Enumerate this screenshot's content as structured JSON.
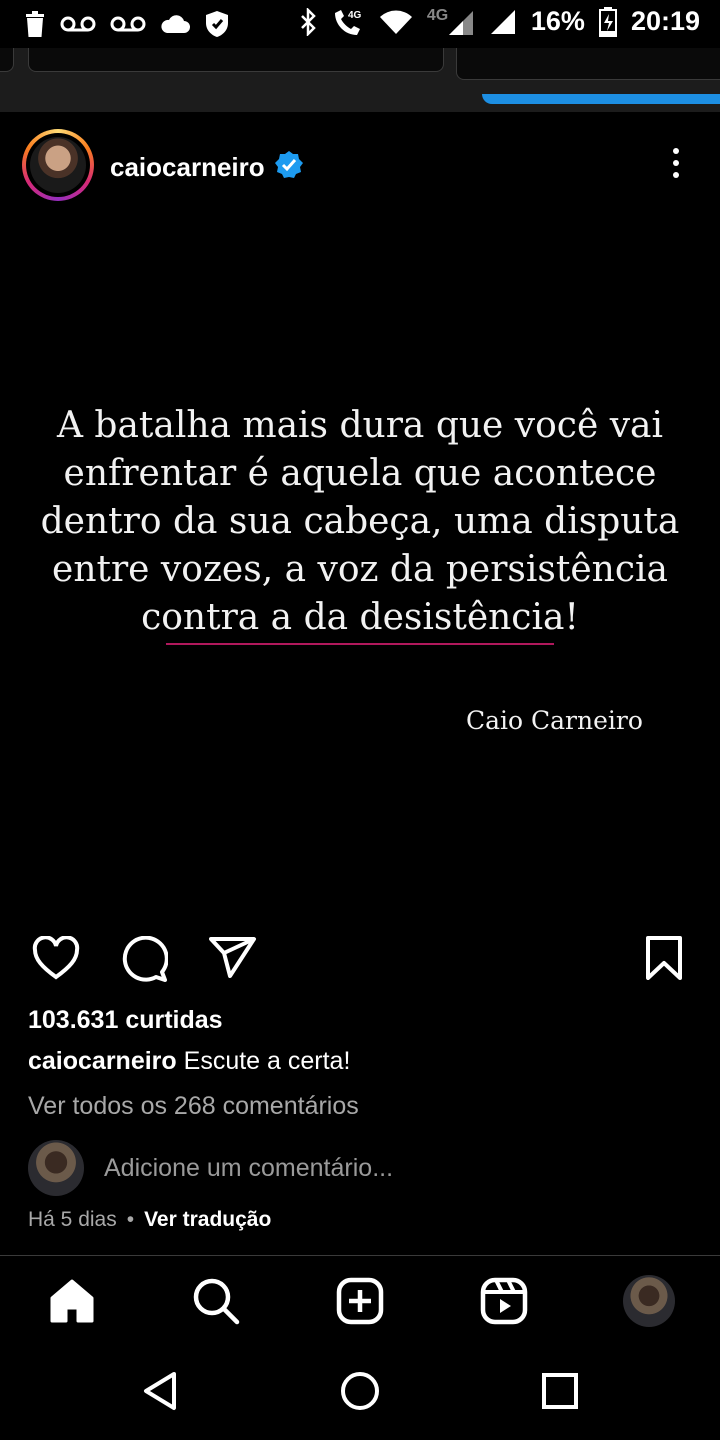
{
  "status_bar": {
    "icons_left": [
      "trash-icon",
      "voicemail-icon",
      "voicemail-icon",
      "cloud-icon",
      "shield-icon"
    ],
    "icons_right": [
      "bluetooth-icon",
      "volte-call-icon",
      "wifi-icon",
      "signal-4g-icon",
      "signal-icon",
      "battery-charging-icon"
    ],
    "network_label": "4G",
    "call_badge": "4G",
    "battery": "16%",
    "time": "20:19"
  },
  "post": {
    "username": "caiocarneiro",
    "verified": true,
    "quote_lines": [
      "A batalha mais dura que você vai",
      "enfrentar é aquela que acontece",
      "dentro da sua cabeça, uma disputa",
      "entre vozes, a voz da persistência",
      "contra a da desistência!"
    ],
    "author": "Caio Carneiro",
    "accent_color": "#b0185c",
    "likes": "103.631 curtidas",
    "caption_user": "caiocarneiro",
    "caption_text": "Escute a certa!",
    "view_comments": "Ver todos os 268 comentários",
    "comment_placeholder": "Adicione um comentário...",
    "time_ago": "Há 5 dias",
    "separator": "•",
    "translate": "Ver tradução"
  },
  "actions": [
    "like-icon",
    "comment-icon",
    "share-icon",
    "save-icon"
  ],
  "bottom_nav": [
    "home-icon",
    "search-icon",
    "create-icon",
    "reels-icon",
    "profile-avatar"
  ],
  "system_nav": [
    "back-button",
    "home-button",
    "recents-button"
  ]
}
